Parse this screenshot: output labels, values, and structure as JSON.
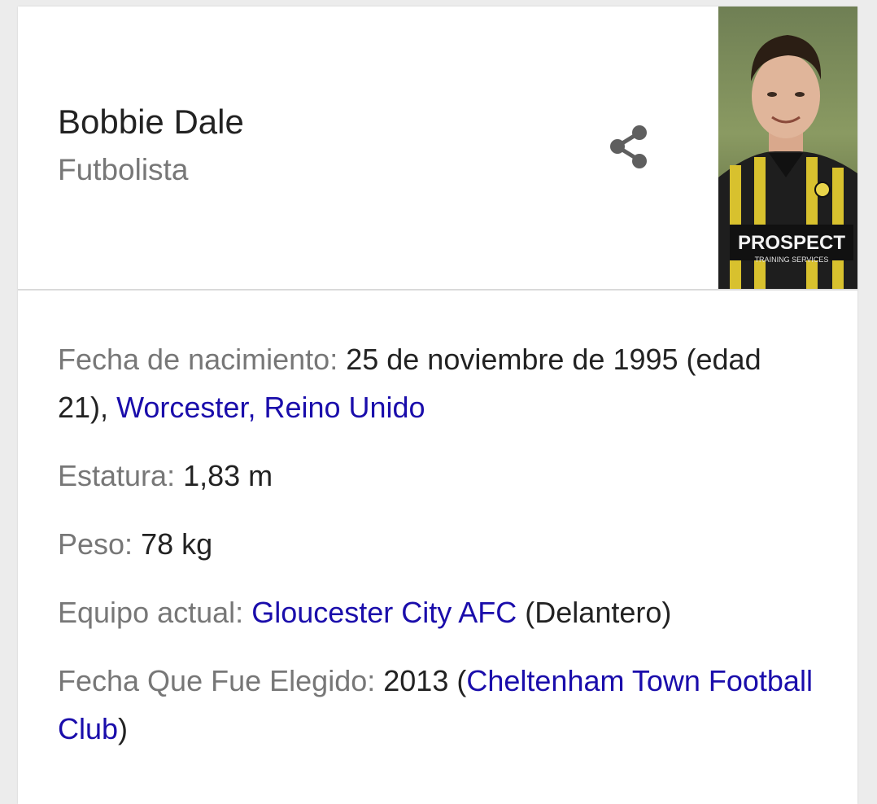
{
  "entity": {
    "name": "Bobbie Dale",
    "type": "Futbolista",
    "share_icon": "share-icon",
    "photo_icon": "player-photo"
  },
  "colors": {
    "link": "#1a0dab",
    "label": "#777777",
    "text": "#222222"
  },
  "photo_text": {
    "sponsor": "PROSPECT",
    "sponsor_sub": "TRAINING SERVICES"
  },
  "facts": {
    "birth": {
      "label": "Fecha de nacimiento:",
      "value": "25 de noviembre de 1995 (edad 21),",
      "place_link": "Worcester, Reino Unido"
    },
    "height": {
      "label": "Estatura:",
      "value": "1,83 m"
    },
    "weight": {
      "label": "Peso:",
      "value": "78 kg"
    },
    "team": {
      "label": "Equipo actual:",
      "team_link": "Gloucester City AFC",
      "position": "(Delantero)"
    },
    "drafted": {
      "label": "Fecha Que Fue Elegido:",
      "year": "2013",
      "open_paren": "(",
      "club_link": "Cheltenham Town Football Club",
      "close_paren": ")"
    }
  }
}
